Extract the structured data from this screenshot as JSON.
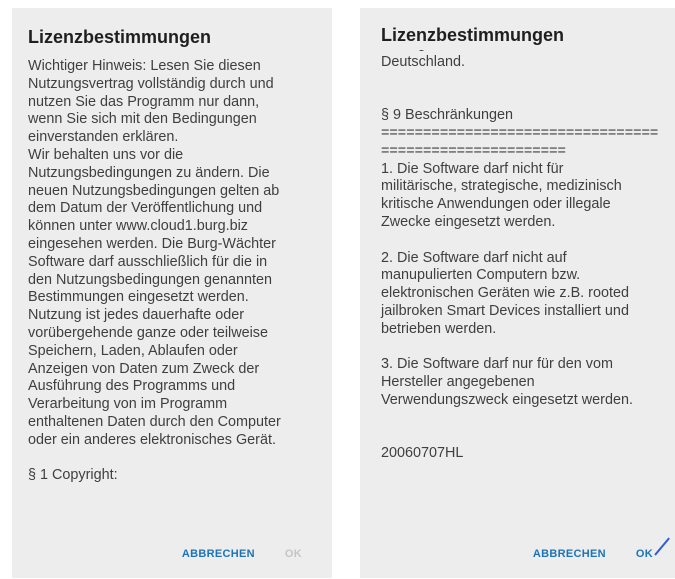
{
  "left_dialog": {
    "title": "Lizenzbestimmungen",
    "body": "Wichtiger Hinweis: Lesen Sie diesen\nNutzungsvertrag vollständig durch und\nnutzen Sie das Programm nur dann,\nwenn Sie sich mit den Bedingungen\neinverstanden erklären.\nWir behalten uns vor die\nNutzungsbedingungen zu ändern. Die\nneuen Nutzungsbedingungen gelten ab\ndem Datum der Veröffentlichung und\nkönnen unter www.cloud1.burg.biz\neingesehen werden.  Die Burg-Wächter\nSoftware darf ausschließlich für die in\nden Nutzungsbedingungen genannten\nBestimmungen eingesetzt werden.\nNutzung ist jedes dauerhafte oder\nvorübergehende ganze oder teilweise\nSpeichern, Laden, Ablaufen oder\nAnzeigen von Daten zum Zweck der\nAusführung des Programms und\nVerarbeitung von im Programm\nenthaltenen  Daten durch den Computer\noder ein anderes elektronisches Gerät.\n\n§ 1 Copyright:",
    "cancel_label": "ABBRECHEN",
    "ok_label": "OK",
    "ok_enabled": false
  },
  "right_dialog": {
    "title": "Lizenzbestimmungen",
    "body": "Streitigkeiten ist, Wetter, Ruhr,\nDeutschland.\n\n\n§ 9 Beschränkungen\n=================================\n======================\n1. Die Software darf nicht für\nmilitärische, strategische, medizinisch\nkritische Anwendungen oder illegale\nZwecke eingesetzt werden.\n\n2. Die Software darf nicht auf\nmanupulierten Computern bzw.\nelektronischen Geräten wie z.B. rooted\njailbroken Smart Devices installiert und\nbetrieben werden.\n\n3. Die Software darf nur für den vom\nHersteller angegebenen\nVerwendungszweck eingesetzt werden.\n\n\n20060707HL",
    "cancel_label": "ABBRECHEN",
    "ok_label": "OK",
    "ok_enabled": true
  },
  "colors": {
    "dialog_background": "#ededed",
    "accent": "#1d73b8",
    "disabled": "#c5c5c5",
    "pointer": "#2f5bd6"
  }
}
